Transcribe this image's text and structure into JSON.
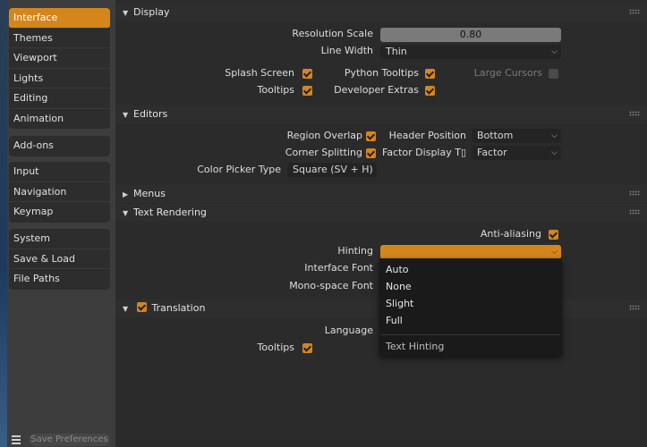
{
  "sidebar": {
    "groups": [
      [
        "Interface",
        "Themes",
        "Viewport",
        "Lights",
        "Editing",
        "Animation"
      ],
      [
        "Add-ons"
      ],
      [
        "Input",
        "Navigation",
        "Keymap"
      ],
      [
        "System",
        "Save & Load",
        "File Paths"
      ]
    ],
    "active": "Interface",
    "save_label": "Save Preferences"
  },
  "display": {
    "title": "Display",
    "resolution_scale_label": "Resolution Scale",
    "resolution_scale_value": "0.80",
    "line_width_label": "Line Width",
    "line_width_value": "Thin",
    "splash_label": "Splash Screen",
    "python_tooltips_label": "Python Tooltips",
    "large_cursors_label": "Large Cursors",
    "tooltips_label": "Tooltips",
    "developer_extras_label": "Developer Extras"
  },
  "editors": {
    "title": "Editors",
    "region_overlap_label": "Region Overlap",
    "header_position_label": "Header Position",
    "header_position_value": "Bottom",
    "corner_splitting_label": "Corner Splitting",
    "factor_display_label": "Factor Display T▯",
    "factor_display_value": "Factor",
    "color_picker_label": "Color Picker Type",
    "color_picker_value": "Square (SV + H)"
  },
  "menus": {
    "title": "Menus"
  },
  "text_rendering": {
    "title": "Text Rendering",
    "antialiasing_label": "Anti-aliasing",
    "hinting_label": "Hinting",
    "interface_font_label": "Interface Font",
    "monospace_font_label": "Mono-space Font"
  },
  "translation": {
    "title": "Translation",
    "language_label": "Language",
    "tooltips_label": "Tooltips"
  },
  "hinting_popup": {
    "options": [
      "Auto",
      "None",
      "Slight",
      "Full"
    ],
    "title": "Text Hinting"
  },
  "colors": {
    "accent": "#d4861c",
    "panel": "#2b2b2b",
    "sidebar": "#3d3d3d"
  }
}
